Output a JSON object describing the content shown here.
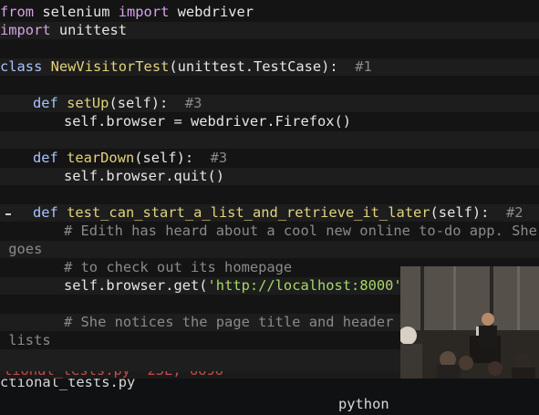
{
  "code": {
    "l1_kw": "from",
    "l1_a": " selenium ",
    "l1_kw2": "import",
    "l1_b": " webdriver",
    "l2_kw": "import",
    "l2_a": " unittest",
    "l4_kw": "class",
    "l4_name": "NewVisitorTest",
    "l4_args": "(unittest.TestCase):",
    "l4_cmt": "  #1",
    "l6_def": "def",
    "l6_fn": "setUp",
    "l6_args": "(self):",
    "l6_cmt": "  #3",
    "l7_code": "self.browser = webdriver.Firefox()",
    "l9_def": "def",
    "l9_fn": "tearDown",
    "l9_args": "(self):",
    "l9_cmt": "  #3",
    "l10_code": "self.browser.quit()",
    "l12_def": "def",
    "l12_fn": "test_can_start_a_list_and_retrieve_it_later",
    "l12_args": "(self):",
    "l12_cmt": "  #2",
    "l13_cmt": "# Edith has heard about a cool new online to-do app. She",
    "l14_cmt": " goes",
    "l15_cmt": "# to check out its homepage",
    "l16_a": "self.browser.get(",
    "l16_str": "'http://localhost:8000'",
    "l16_b": ")",
    "l18_cmt": "# She notices the page title and header me",
    "l19_cmt": " lists"
  },
  "status_bar": {
    "filename": "ctional_tests.py",
    "filetype": "python"
  },
  "command_line": {
    "text": "tional_tests.py\" 23L, 6696"
  },
  "colors": {
    "background": "#141414",
    "keyword": "#d6a3e8",
    "def_keyword": "#a9c3ff",
    "function_name": "#e3d27c",
    "comment": "#8a8a8a",
    "string": "#a8d86a"
  },
  "overlay": {
    "type": "webcam-video",
    "scene": "conference-speaker-at-podium"
  }
}
